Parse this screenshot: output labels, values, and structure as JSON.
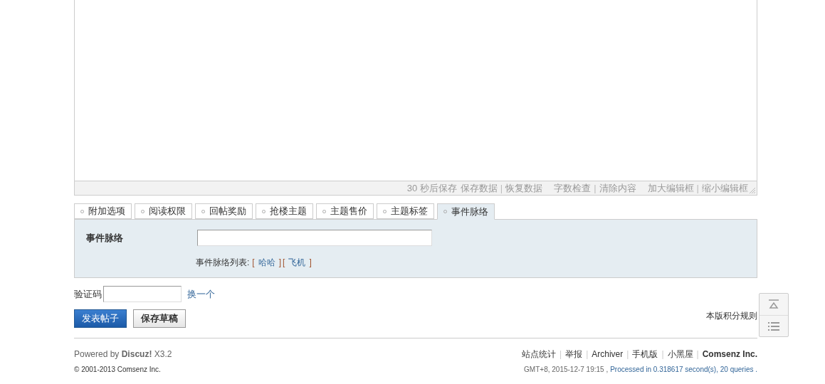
{
  "editor": {
    "autosave": "30 秒后保存",
    "groups": [
      [
        "保存数据",
        "恢复数据"
      ],
      [
        "字数检查",
        "清除内容"
      ],
      [
        "加大编辑框",
        "缩小编辑框"
      ]
    ],
    "separator": "|"
  },
  "tabs": [
    {
      "label": "附加选项",
      "selected": false
    },
    {
      "label": "阅读权限",
      "selected": false
    },
    {
      "label": "回帖奖励",
      "selected": false
    },
    {
      "label": "抢楼主题",
      "selected": false
    },
    {
      "label": "主题售价",
      "selected": false
    },
    {
      "label": "主题标签",
      "selected": false
    },
    {
      "label": "事件脉络",
      "selected": true
    }
  ],
  "panel": {
    "label": "事件脉络",
    "list_label": "事件脉络列表:",
    "items": [
      {
        "open": "[",
        "label": "哈哈",
        "close": "]"
      },
      {
        "open": "[",
        "label": "飞机",
        "close": "]"
      }
    ]
  },
  "captcha": {
    "label": "验证码",
    "refresh": "换一个"
  },
  "buttons": {
    "submit": "发表帖子",
    "draft": "保存草稿"
  },
  "rules_link": "本版积分规则",
  "footer": {
    "powered": "Powered by **Discuz!** X3.2",
    "copyright": "© 2001-2013 Comsenz Inc.",
    "links": [
      {
        "label": "站点统计",
        "bold": false
      },
      {
        "label": "举报",
        "bold": false
      },
      {
        "label": "Archiver",
        "bold": false
      },
      {
        "label": "手机版",
        "bold": false
      },
      {
        "label": "小黑屋",
        "bold": false
      },
      {
        "label": "Comsenz Inc.",
        "bold": true
      }
    ],
    "separator": "|",
    "time": "GMT+8, 2015-12-7 19:15 ,",
    "processed": "Processed in 0.318617 second(s), 20 queries ."
  }
}
